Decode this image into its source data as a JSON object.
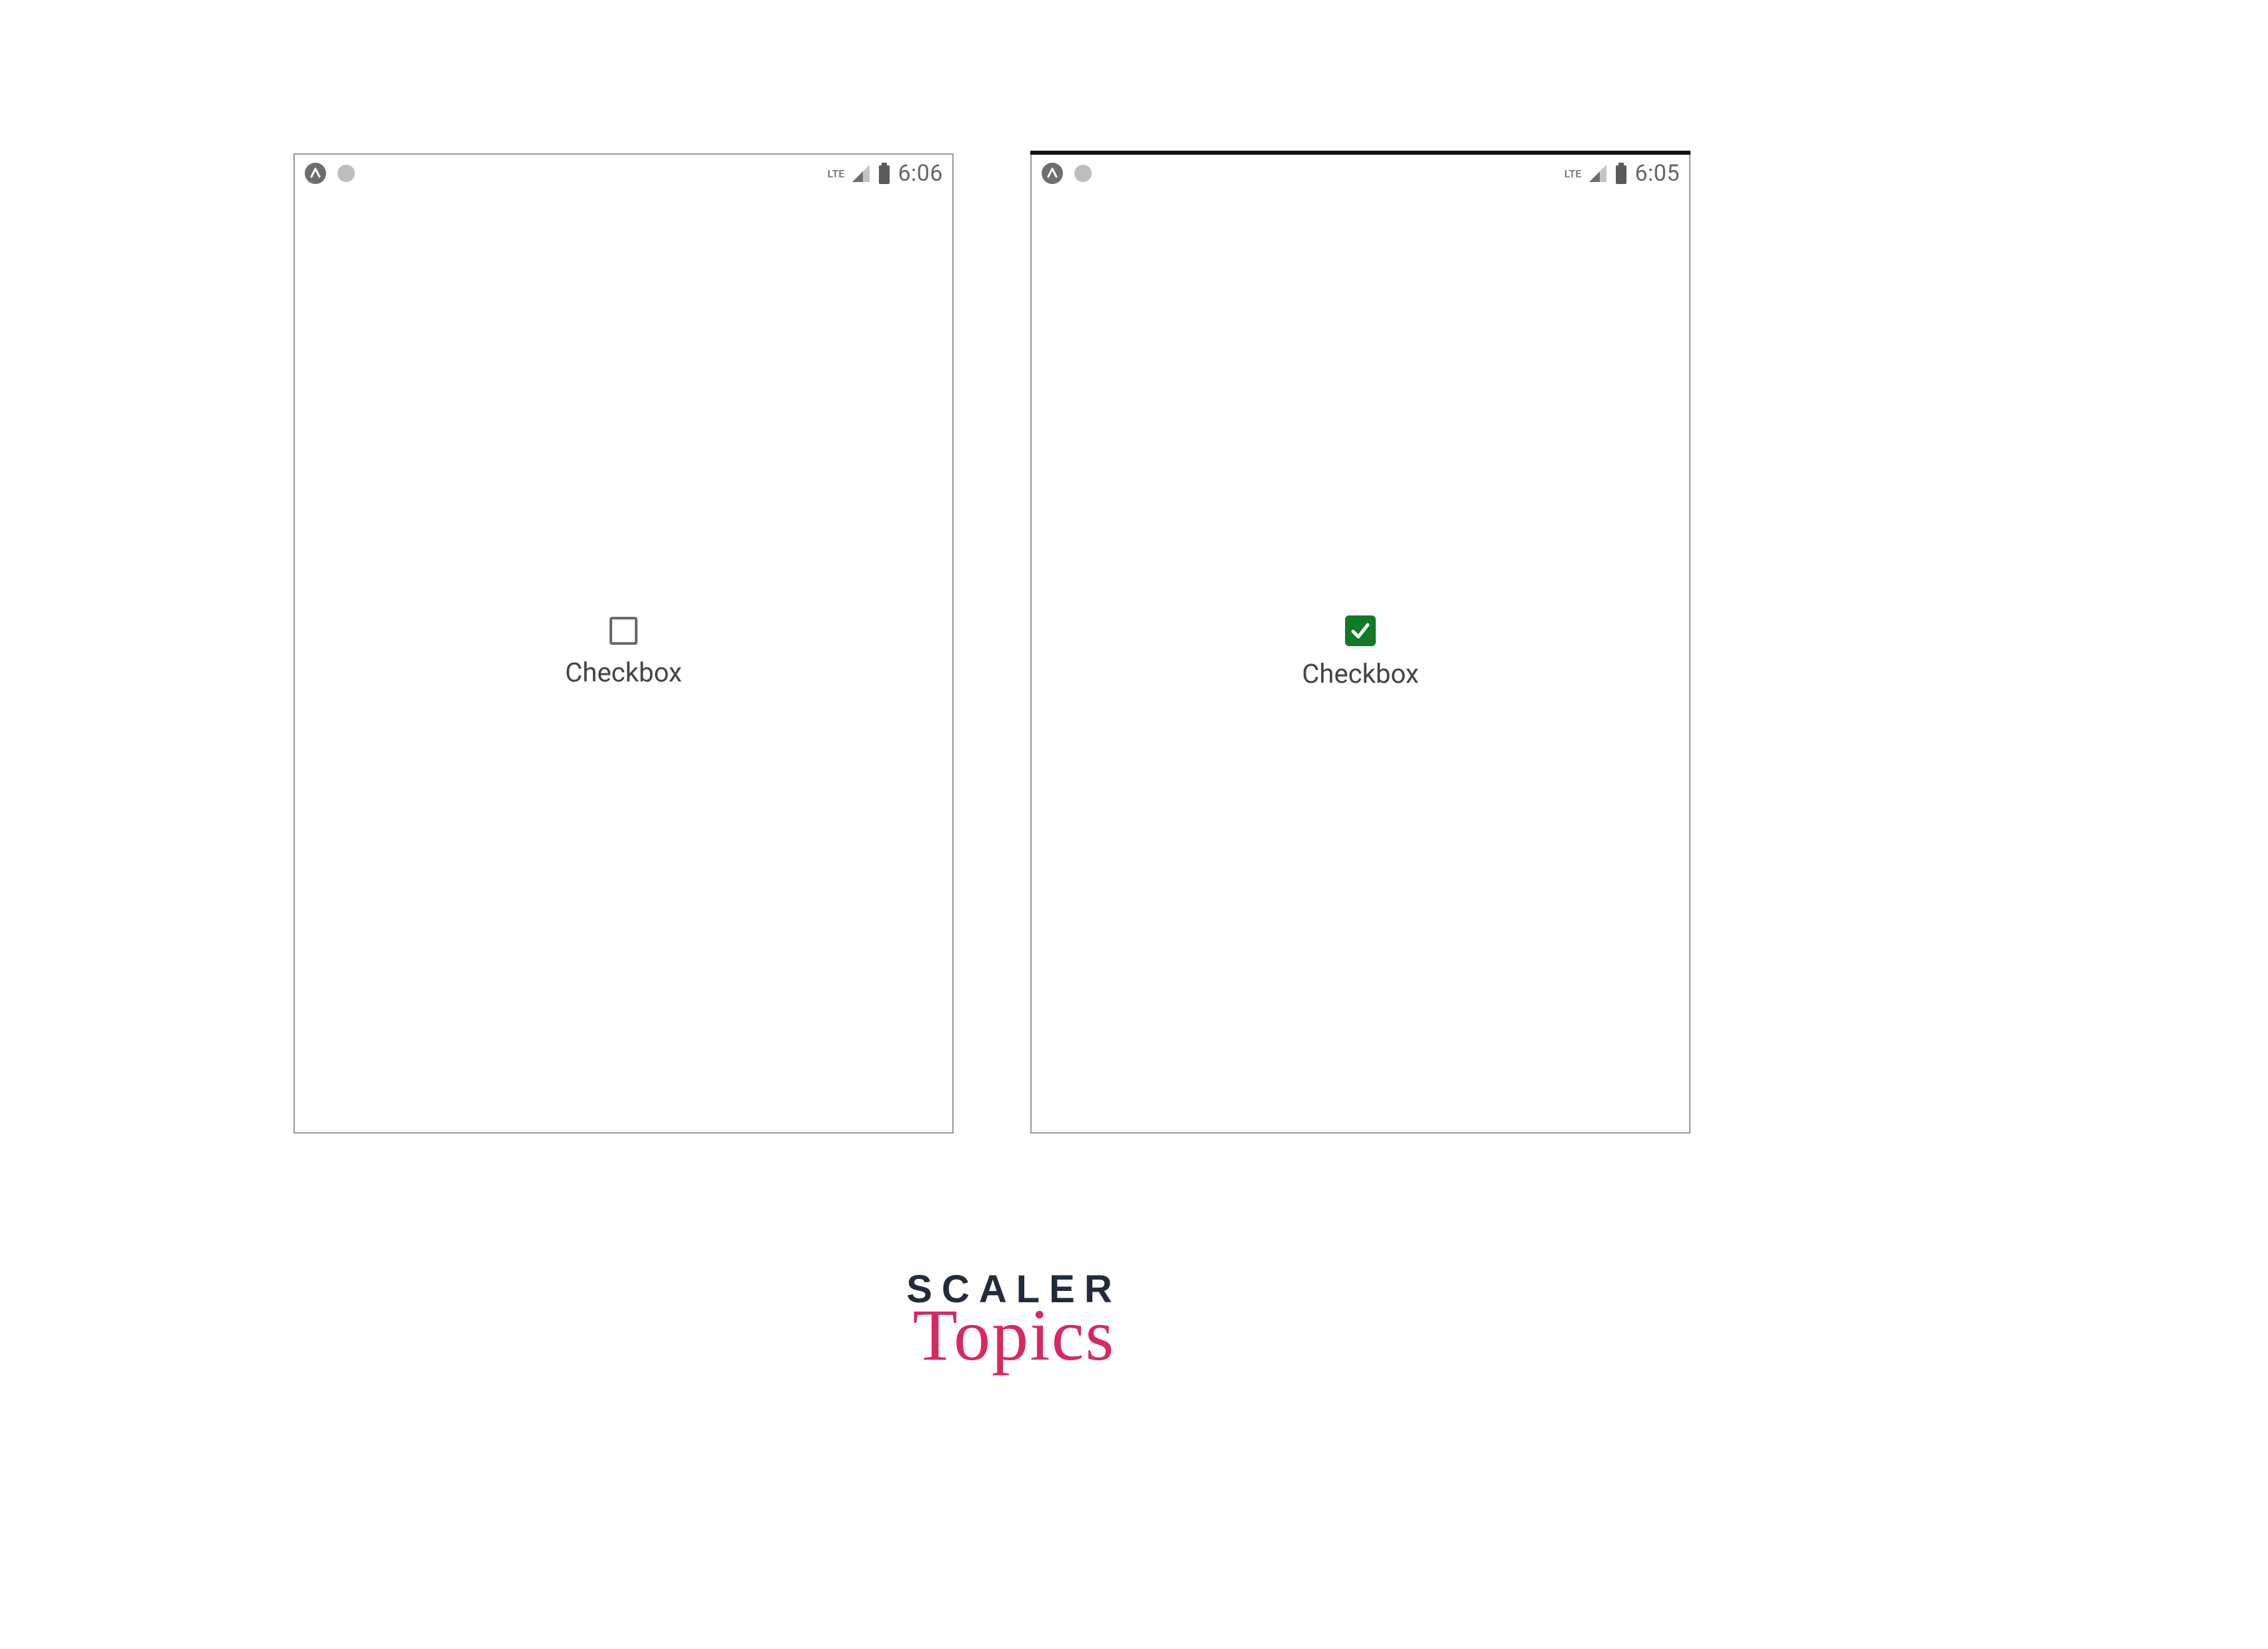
{
  "screens": {
    "left": {
      "statusbar": {
        "network_label": "LTE",
        "clock": "6:06"
      },
      "checkbox": {
        "label": "Checkbox",
        "checked": false
      }
    },
    "right": {
      "statusbar": {
        "network_label": "LTE",
        "clock": "6:05"
      },
      "checkbox": {
        "label": "Checkbox",
        "checked": true
      }
    }
  },
  "branding": {
    "line1": "SCALER",
    "line2": "Topics"
  },
  "colors": {
    "checkbox_checked_bg": "#117a24",
    "brand_accent": "#d72866",
    "brand_text": "#232b3b"
  }
}
